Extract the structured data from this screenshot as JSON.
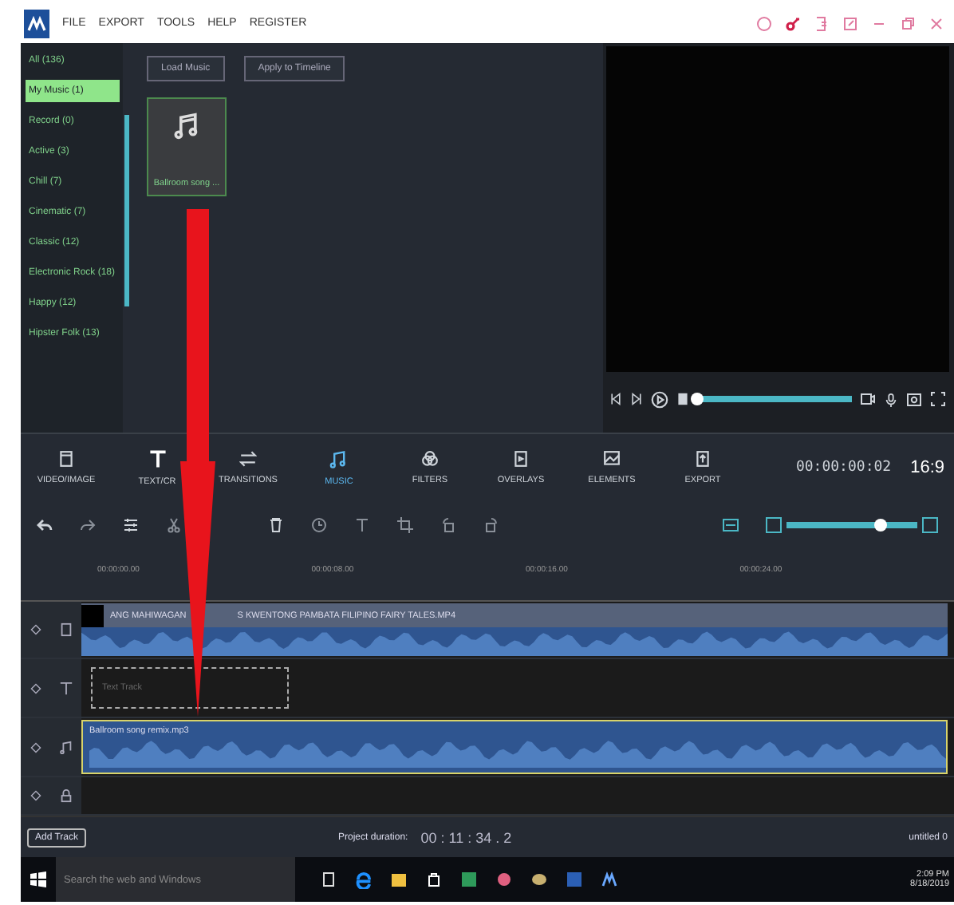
{
  "menu": [
    "FILE",
    "EXPORT",
    "TOOLS",
    "HELP",
    "REGISTER"
  ],
  "media_buttons": [
    "Load Music",
    "Apply to Timeline"
  ],
  "categories": [
    {
      "label": "All (136)",
      "selected": false
    },
    {
      "label": "My Music (1)",
      "selected": true
    },
    {
      "label": "Record (0)",
      "selected": false
    },
    {
      "label": "Active (3)",
      "selected": false
    },
    {
      "label": "Chill (7)",
      "selected": false
    },
    {
      "label": "Cinematic (7)",
      "selected": false
    },
    {
      "label": "Classic (12)",
      "selected": false
    },
    {
      "label": "Electronic Rock (18)",
      "selected": false
    },
    {
      "label": "Happy (12)",
      "selected": false
    },
    {
      "label": "Hipster Folk (13)",
      "selected": false
    }
  ],
  "media_items": [
    {
      "label": "Ballroom song ..."
    }
  ],
  "tools": [
    {
      "kind": "video",
      "label": "VIDEO/IMAGE",
      "selected": false
    },
    {
      "kind": "text",
      "label": "TEXT/CR",
      "selected": false
    },
    {
      "kind": "transitions",
      "label": "TRANSITIONS",
      "selected": false
    },
    {
      "kind": "music",
      "label": "MUSIC",
      "selected": true
    },
    {
      "kind": "filters",
      "label": "FILTERS",
      "selected": false
    },
    {
      "kind": "overlays",
      "label": "OVERLAYS",
      "selected": false
    },
    {
      "kind": "elements",
      "label": "ELEMENTS",
      "selected": false
    },
    {
      "kind": "export",
      "label": "EXPORT",
      "selected": false
    }
  ],
  "timecode": "00:00:00:02",
  "aspect": "16:9",
  "zoom": {
    "level": 0.72
  },
  "ruler": [
    "00:00:00.00",
    "00:00:08.00",
    "00:00:16.00",
    "00:00:24.00"
  ],
  "tracks": [
    {
      "kind": "video",
      "clip_parts": [
        "ANG MAHIWAGAN",
        "S KWENTONG PAMBATA  FILIPINO FAIRY TALES.MP4"
      ]
    },
    {
      "kind": "text",
      "placeholder": "Text Track"
    },
    {
      "kind": "audio",
      "clip": "Ballroom song remix.mp3",
      "selected": true
    },
    {
      "kind": "locked"
    }
  ],
  "footer": {
    "add_track": "Add Track",
    "duration_label": "Project duration:",
    "duration": "00 : 11 : 34 . 2",
    "project": "untitled 0"
  },
  "taskbar": {
    "search": "Search the web and Windows",
    "time": "2:09 PM",
    "date": "8/18/2019"
  }
}
